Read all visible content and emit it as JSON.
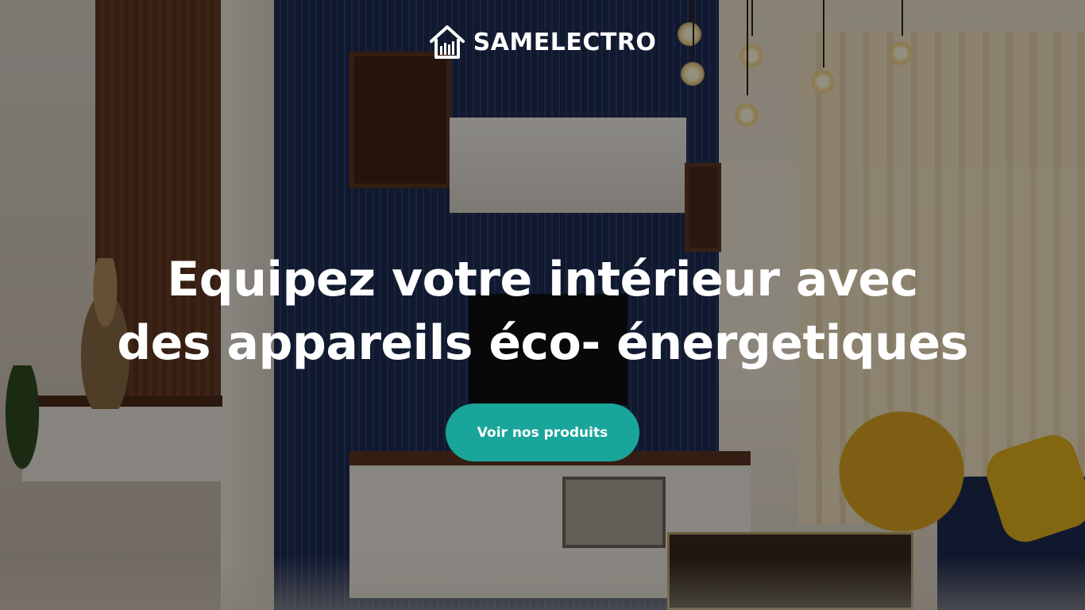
{
  "brand": {
    "name": "SAMELECTRO",
    "icon": "house-logo-icon"
  },
  "hero": {
    "headline_line1": "Equipez votre intérieur avec",
    "headline_line2": "des appareils éco- énergetiques",
    "cta_label": "Voir nos produits",
    "cta_color": "#1aa59a",
    "overlay_color": "rgba(0,0,0,0.42)",
    "background_image": "living-room-photo"
  }
}
